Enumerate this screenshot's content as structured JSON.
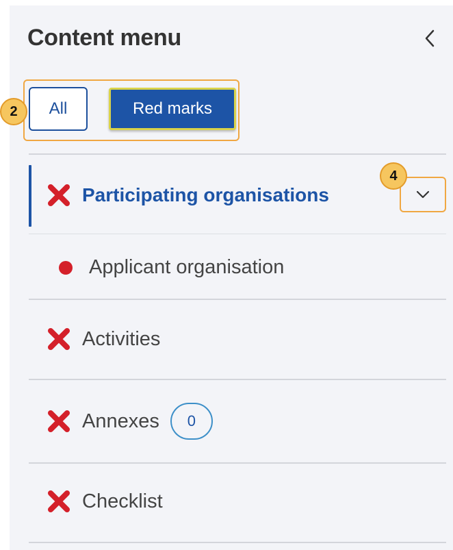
{
  "header": {
    "title": "Content menu",
    "collapse_icon": "chevron-left-icon"
  },
  "filters": {
    "all_label": "All",
    "red_marks_label": "Red marks",
    "selected": "Red marks"
  },
  "callouts": {
    "filters_number": "2",
    "expand_number": "4"
  },
  "menu": {
    "items": [
      {
        "label": "Participating organisations",
        "status_icon": "red-x-icon",
        "active": true,
        "expand_icon": "chevron-down-icon"
      },
      {
        "label": "Applicant organisation",
        "status_icon": "red-dot-icon",
        "sub_item": true
      },
      {
        "label": "Activities",
        "status_icon": "red-x-icon"
      },
      {
        "label": "Annexes",
        "status_icon": "red-x-icon",
        "count": "0"
      },
      {
        "label": "Checklist",
        "status_icon": "red-x-icon"
      }
    ]
  },
  "colors": {
    "accent_blue": "#1d54a6",
    "error_red": "#d4202a",
    "callout_orange": "#f0a742",
    "panel_bg": "#f3f4f8"
  }
}
